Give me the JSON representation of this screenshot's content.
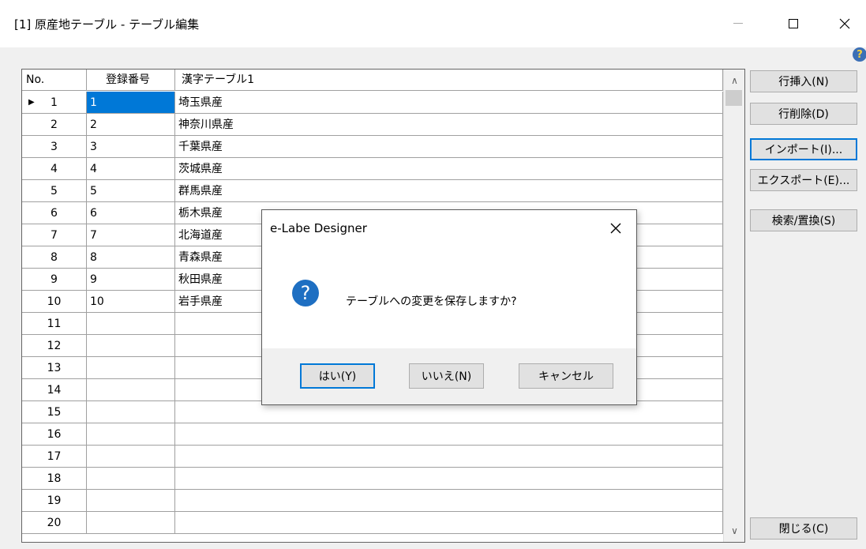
{
  "window": {
    "title": "[1] 原産地テーブル - テーブル編集",
    "minimize_icon": "minimize-icon",
    "maximize_icon": "maximize-icon",
    "close_icon": "close-icon",
    "help_glyph": "?"
  },
  "grid": {
    "columns": [
      "No.",
      "登録番号",
      "漢字テーブル1"
    ],
    "rows": [
      {
        "no": "1",
        "reg": "1",
        "name": "埼玉県産"
      },
      {
        "no": "2",
        "reg": "2",
        "name": "神奈川県産"
      },
      {
        "no": "3",
        "reg": "3",
        "name": "千葉県産"
      },
      {
        "no": "4",
        "reg": "4",
        "name": "茨城県産"
      },
      {
        "no": "5",
        "reg": "5",
        "name": "群馬県産"
      },
      {
        "no": "6",
        "reg": "6",
        "name": "栃木県産"
      },
      {
        "no": "7",
        "reg": "7",
        "name": "北海道産"
      },
      {
        "no": "8",
        "reg": "8",
        "name": "青森県産"
      },
      {
        "no": "9",
        "reg": "9",
        "name": "秋田県産"
      },
      {
        "no": "10",
        "reg": "10",
        "name": "岩手県産"
      },
      {
        "no": "11",
        "reg": "",
        "name": ""
      },
      {
        "no": "12",
        "reg": "",
        "name": ""
      },
      {
        "no": "13",
        "reg": "",
        "name": ""
      },
      {
        "no": "14",
        "reg": "",
        "name": ""
      },
      {
        "no": "15",
        "reg": "",
        "name": ""
      },
      {
        "no": "16",
        "reg": "",
        "name": ""
      },
      {
        "no": "17",
        "reg": "",
        "name": ""
      },
      {
        "no": "18",
        "reg": "",
        "name": ""
      },
      {
        "no": "19",
        "reg": "",
        "name": ""
      },
      {
        "no": "20",
        "reg": "",
        "name": ""
      }
    ],
    "current_row_marker": "▶",
    "scroll_up": "∧",
    "scroll_down": "∨"
  },
  "side_buttons": {
    "insert_row": "行挿入(N)",
    "delete_row": "行削除(D)",
    "import": "インポート(I)...",
    "export": "エクスポート(E)...",
    "search_replace": "検索/置換(S)",
    "close": "閉じる(C)"
  },
  "dialog": {
    "title": "e-Labe Designer",
    "close_glyph": "✕",
    "icon_glyph": "?",
    "message": "テーブルへの変更を保存しますか?",
    "yes": "はい(Y)",
    "no": "いいえ(N)",
    "cancel": "キャンセル"
  },
  "colors": {
    "selection": "#0078d7",
    "question_icon": "#1e6fc2"
  }
}
